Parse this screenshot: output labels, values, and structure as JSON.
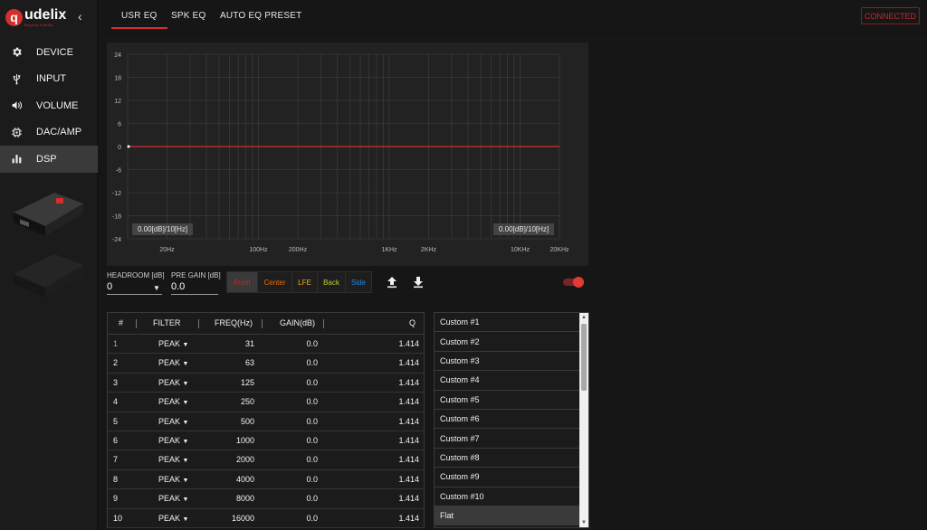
{
  "app": {
    "brand": "udelix",
    "brand_letter": "q",
    "tagline": "Beyond Fidelity"
  },
  "sidebar": {
    "items": [
      {
        "label": "DEVICE",
        "icon": "gear-icon"
      },
      {
        "label": "INPUT",
        "icon": "usb-icon"
      },
      {
        "label": "VOLUME",
        "icon": "speaker-icon"
      },
      {
        "label": "DAC/AMP",
        "icon": "chip-icon"
      },
      {
        "label": "DSP",
        "icon": "bar-chart-icon",
        "active": true
      }
    ]
  },
  "tabs": [
    {
      "label": "USR EQ",
      "active": true
    },
    {
      "label": "SPK EQ"
    },
    {
      "label": "AUTO EQ PRESET"
    }
  ],
  "status": {
    "label": "CONNECTED",
    "color": "#c62828"
  },
  "graph": {
    "y_ticks": [
      "24",
      "18",
      "12",
      "6",
      "0",
      "-6",
      "-12",
      "-18",
      "-24"
    ],
    "x_ticks": [
      "20Hz",
      "100Hz",
      "200Hz",
      "1KHz",
      "2KHz",
      "10KHz",
      "20KHz"
    ],
    "left_readout": "0.00[dB]/10[Hz]",
    "right_readout": "0.00[dB]/10[Hz]",
    "curve_color": "#d32f2f"
  },
  "controls": {
    "headroom_label": "HEADROOM [dB]",
    "headroom_value": "0",
    "pregain_label": "PRE GAIN [dB]",
    "pregain_value": "0.0",
    "channels": [
      {
        "label": "Front",
        "color": "#c62828",
        "active": true
      },
      {
        "label": "Center",
        "color": "#ef6c00"
      },
      {
        "label": "LFE",
        "color": "#f9a825"
      },
      {
        "label": "Back",
        "color": "#c0ca33"
      },
      {
        "label": "Side",
        "color": "#1e88e5"
      }
    ],
    "upload_icon": "upload-icon",
    "download_icon": "download-icon",
    "toggle_on": true
  },
  "table": {
    "headers": {
      "idx": "#",
      "filter": "FILTER",
      "freq": "FREQ(Hz)",
      "gain": "GAIN(dB)",
      "q": "Q"
    },
    "rows": [
      {
        "idx": "1",
        "filter": "PEAK",
        "freq": "31",
        "gain": "0.0",
        "q": "1.414"
      },
      {
        "idx": "2",
        "filter": "PEAK",
        "freq": "63",
        "gain": "0.0",
        "q": "1.414"
      },
      {
        "idx": "3",
        "filter": "PEAK",
        "freq": "125",
        "gain": "0.0",
        "q": "1.414"
      },
      {
        "idx": "4",
        "filter": "PEAK",
        "freq": "250",
        "gain": "0.0",
        "q": "1.414"
      },
      {
        "idx": "5",
        "filter": "PEAK",
        "freq": "500",
        "gain": "0.0",
        "q": "1.414"
      },
      {
        "idx": "6",
        "filter": "PEAK",
        "freq": "1000",
        "gain": "0.0",
        "q": "1.414"
      },
      {
        "idx": "7",
        "filter": "PEAK",
        "freq": "2000",
        "gain": "0.0",
        "q": "1.414"
      },
      {
        "idx": "8",
        "filter": "PEAK",
        "freq": "4000",
        "gain": "0.0",
        "q": "1.414"
      },
      {
        "idx": "9",
        "filter": "PEAK",
        "freq": "8000",
        "gain": "0.0",
        "q": "1.414"
      },
      {
        "idx": "10",
        "filter": "PEAK",
        "freq": "16000",
        "gain": "0.0",
        "q": "1.414"
      }
    ]
  },
  "presets": {
    "items": [
      "Custom #1",
      "Custom #2",
      "Custom #3",
      "Custom #4",
      "Custom #5",
      "Custom #6",
      "Custom #7",
      "Custom #8",
      "Custom #9",
      "Custom #10",
      "Flat"
    ],
    "selected": "Flat"
  }
}
